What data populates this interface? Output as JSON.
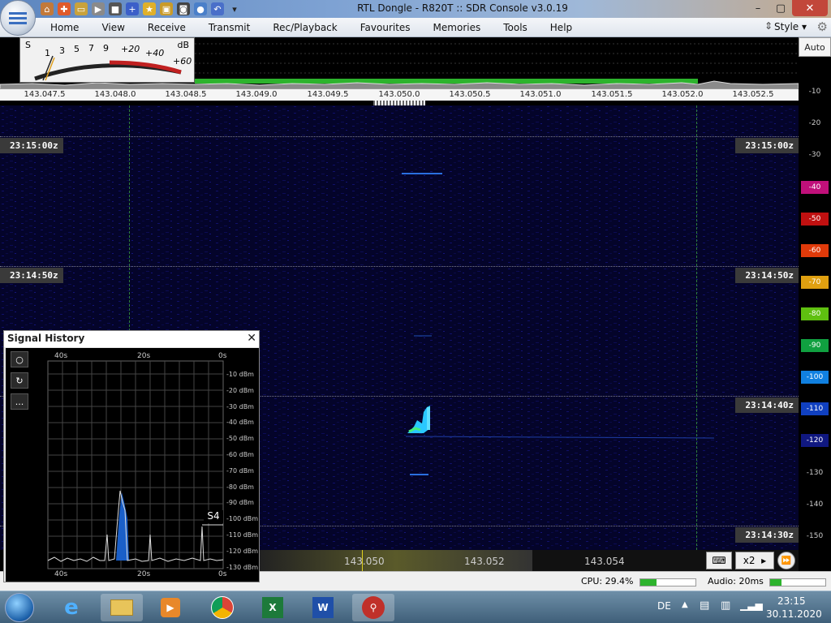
{
  "window": {
    "title": "RTL Dongle - R820T :: SDR Console v3.0.19"
  },
  "menu": {
    "items": [
      "Home",
      "View",
      "Receive",
      "Transmit",
      "Rec/Playback",
      "Favourites",
      "Memories",
      "Tools",
      "Help"
    ],
    "style_label": "Style"
  },
  "smeter": {
    "s_label": "S",
    "db_label": "dB",
    "s_ticks": [
      "1",
      "3",
      "5",
      "7",
      "9"
    ],
    "plus_ticks": [
      "+20",
      "+40",
      "+60"
    ]
  },
  "freq_scale": [
    "143.047.5",
    "143.048.0",
    "143.048.5",
    "143.049.0",
    "143.049.5",
    "143.050.0",
    "143.050.5",
    "143.051.0",
    "143.051.5",
    "143.052.0",
    "143.052.5"
  ],
  "db_scale": {
    "auto_label": "Auto",
    "labels": [
      "-10",
      "-20",
      "-30",
      "-40",
      "-50",
      "-60",
      "-70",
      "-80",
      "-90",
      "-100",
      "-110",
      "-120",
      "-130",
      "-140",
      "-150"
    ]
  },
  "colors": {
    "band_green": "#2db32d",
    "wf_bg": "#04042a",
    "signal": "#29c8ff"
  },
  "waterfall": {
    "timestamps": [
      "23:15:00z",
      "23:14:50z",
      "23:14:40z",
      "23:14:30z"
    ]
  },
  "bottom": {
    "freqs": [
      "143.050",
      "143.052",
      "143.054"
    ],
    "zoom": "x2"
  },
  "status": {
    "cpu": "CPU: 29.4%",
    "cpu_level": 0.29,
    "audio": "Audio: 20ms",
    "audio_level": 0.2
  },
  "signal_history": {
    "title": "Signal History",
    "top_time_labels": [
      "40s",
      "20s",
      "0s"
    ],
    "bottom_time_labels": [
      "40s",
      "20s",
      "0s"
    ],
    "dbm_labels": [
      "-10 dBm",
      "-20 dBm",
      "-30 dBm",
      "-40 dBm",
      "-50 dBm",
      "-60 dBm",
      "-70 dBm",
      "-80 dBm",
      "-90 dBm",
      "-100 dBm",
      "-110 dBm",
      "-120 dBm",
      "-130 dBm"
    ],
    "s_readout": "S4",
    "button_more": "..."
  },
  "taskbar": {
    "lang": "DE",
    "time": "23:15",
    "date": "30.11.2020"
  }
}
